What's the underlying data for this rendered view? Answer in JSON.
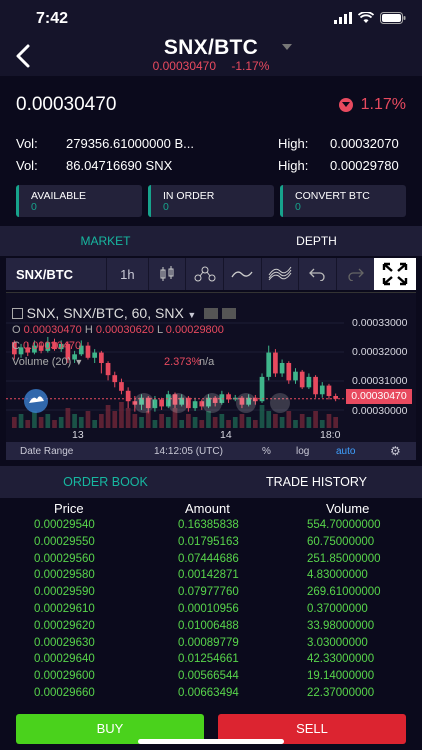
{
  "status": {
    "time": "7:42"
  },
  "header": {
    "pair": "SNX/BTC",
    "sub_price": "0.00030470",
    "sub_change": "-1.17%"
  },
  "ticker": {
    "last_price": "0.00030470",
    "change": "1.17%"
  },
  "stats": {
    "vol_label": "Vol:",
    "vol_1": "279356.61000000 B...",
    "vol_2": "86.04716690 SNX",
    "high_label": "High:",
    "high_1": "0.00032070",
    "high_2": "0.00029780"
  },
  "wallet": [
    {
      "label": "AVAILABLE",
      "value": "0"
    },
    {
      "label": "IN ORDER",
      "value": "0"
    },
    {
      "label": "CONVERT BTC",
      "value": "0"
    }
  ],
  "view_tabs": {
    "market": "MARKET",
    "depth": "DEPTH"
  },
  "chart_toolbar": {
    "symbol": "SNX/BTC",
    "interval": "1h"
  },
  "chart_overlay": {
    "symbol_line": "SNX, SNX/BTC, 60, SNX",
    "o_label": "O",
    "o_val": "0.00030470",
    "h_label": "H",
    "h_val": "0.00030620",
    "l_label": "L",
    "l_val": "0.00029800",
    "c_label": "C",
    "c_val": "0.00030470",
    "volume_label": "Volume (20)",
    "volume_pct": "2.373%",
    "volume_na": "n/a"
  },
  "chart_footer": {
    "date_range": "Date Range",
    "time": "14:12:05 (UTC)",
    "pct": "%",
    "log": "log",
    "auto": "auto"
  },
  "chart_data": {
    "type": "candlestick",
    "y_ticks": [
      "0.00033000",
      "0.00032000",
      "0.00031000",
      "0.00030000"
    ],
    "x_ticks": [
      "13",
      "14",
      "18:0"
    ],
    "last_price_tag": "0.00030470",
    "ylim": [
      0.000296,
      0.000334
    ],
    "candles": [
      [
        0.000321,
        0.0003175,
        0.0003215,
        0.000316,
        "down"
      ],
      [
        0.0003175,
        0.0003195,
        0.0003205,
        0.0003165,
        "up"
      ],
      [
        0.0003195,
        0.000318,
        0.000321,
        0.000317,
        "down"
      ],
      [
        0.000318,
        0.00032,
        0.0003215,
        0.0003175,
        "up"
      ],
      [
        0.00032,
        0.0003185,
        0.0003212,
        0.0003178,
        "down"
      ],
      [
        0.0003185,
        0.000321,
        0.0003225,
        0.000318,
        "up"
      ],
      [
        0.000321,
        0.000319,
        0.000322,
        0.0003185,
        "down"
      ],
      [
        0.000319,
        0.0003205,
        0.0003215,
        0.0003182,
        "up"
      ],
      [
        0.0003205,
        0.000316,
        0.0003212,
        0.000315,
        "down"
      ],
      [
        0.000316,
        0.0003175,
        0.0003185,
        0.000315,
        "up"
      ],
      [
        0.0003175,
        0.00032,
        0.0003215,
        0.000317,
        "up"
      ],
      [
        0.00032,
        0.0003165,
        0.000321,
        0.000316,
        "down"
      ],
      [
        0.0003165,
        0.000318,
        0.000319,
        0.000315,
        "up"
      ],
      [
        0.000318,
        0.000315,
        0.0003185,
        0.000312,
        "down"
      ],
      [
        0.000315,
        0.0003115,
        0.0003155,
        0.00031,
        "down"
      ],
      [
        0.0003115,
        0.0003095,
        0.0003125,
        0.000308,
        "down"
      ],
      [
        0.0003095,
        0.000307,
        0.0003105,
        0.000306,
        "down"
      ],
      [
        0.000307,
        0.000304,
        0.000308,
        0.000302,
        "down"
      ],
      [
        0.000304,
        0.000303,
        0.0003055,
        0.000301,
        "down"
      ],
      [
        0.000303,
        0.000305,
        0.000306,
        0.0003015,
        "up"
      ],
      [
        0.000305,
        0.000302,
        0.0003055,
        0.0003005,
        "down"
      ],
      [
        0.000302,
        0.0003045,
        0.0003055,
        0.000301,
        "up"
      ],
      [
        0.0003045,
        0.0003025,
        0.000305,
        0.0003015,
        "down"
      ],
      [
        0.0003025,
        0.000306,
        0.000307,
        0.000302,
        "up"
      ],
      [
        0.000306,
        0.000303,
        0.0003065,
        0.000302,
        "down"
      ],
      [
        0.000303,
        0.000305,
        0.000306,
        0.0003025,
        "up"
      ],
      [
        0.000305,
        0.000302,
        0.0003055,
        0.000301,
        "down"
      ],
      [
        0.000302,
        0.000304,
        0.000305,
        0.0003012,
        "up"
      ],
      [
        0.000304,
        0.0003025,
        0.0003045,
        0.0003015,
        "down"
      ],
      [
        0.0003025,
        0.000305,
        0.000306,
        0.000302,
        "up"
      ],
      [
        0.000305,
        0.0003035,
        0.0003055,
        0.0003025,
        "down"
      ],
      [
        0.0003035,
        0.000306,
        0.000307,
        0.000303,
        "up"
      ],
      [
        0.000306,
        0.0003045,
        0.0003065,
        0.0003035,
        "down"
      ],
      [
        0.0003045,
        0.000305,
        0.0003058,
        0.000304,
        "up"
      ],
      [
        0.000305,
        0.000303,
        0.0003055,
        0.000302,
        "down"
      ],
      [
        0.000303,
        0.000305,
        0.000306,
        0.0003025,
        "up"
      ],
      [
        0.000305,
        0.000304,
        0.0003058,
        0.000303,
        "down"
      ],
      [
        0.000304,
        0.000311,
        0.000312,
        0.0003035,
        "up"
      ],
      [
        0.000311,
        0.000318,
        0.00032,
        0.00031,
        "up"
      ],
      [
        0.000318,
        0.000312,
        0.000319,
        0.000311,
        "down"
      ],
      [
        0.000312,
        0.000315,
        0.000316,
        0.000311,
        "up"
      ],
      [
        0.000315,
        0.00031,
        0.0003155,
        0.000309,
        "down"
      ],
      [
        0.00031,
        0.0003125,
        0.0003135,
        0.000309,
        "up"
      ],
      [
        0.0003125,
        0.000308,
        0.000313,
        0.0003075,
        "down"
      ],
      [
        0.000308,
        0.000311,
        0.000312,
        0.0003075,
        "up"
      ],
      [
        0.000311,
        0.000306,
        0.0003115,
        0.000305,
        "down"
      ],
      [
        0.000306,
        0.0003085,
        0.0003095,
        0.000305,
        "up"
      ],
      [
        0.0003085,
        0.0003055,
        0.000309,
        0.0003045,
        "down"
      ],
      [
        0.0003055,
        0.0003047,
        0.0003062,
        0.000304,
        "down"
      ]
    ],
    "volumes": [
      0.4,
      0.5,
      0.3,
      0.6,
      0.4,
      0.5,
      0.3,
      0.4,
      0.7,
      0.5,
      0.4,
      0.6,
      0.3,
      0.5,
      0.8,
      0.6,
      0.9,
      0.7,
      0.5,
      0.4,
      0.6,
      0.3,
      0.5,
      0.4,
      0.7,
      0.3,
      0.5,
      0.4,
      0.3,
      0.6,
      0.4,
      0.5,
      0.3,
      0.4,
      0.5,
      0.4,
      0.3,
      0.8,
      0.6,
      0.5,
      0.4,
      0.6,
      0.3,
      0.5,
      0.4,
      0.6,
      0.3,
      0.5,
      0.4
    ]
  },
  "book_tabs": {
    "order_book": "ORDER BOOK",
    "trade_history": "TRADE HISTORY"
  },
  "book": {
    "headers": {
      "price": "Price",
      "amount": "Amount",
      "volume": "Volume"
    },
    "rows": [
      {
        "price": "0.00029540",
        "amount": "0.16385838",
        "volume": "554.70000000"
      },
      {
        "price": "0.00029550",
        "amount": "0.01795163",
        "volume": "60.75000000"
      },
      {
        "price": "0.00029560",
        "amount": "0.07444686",
        "volume": "251.85000000"
      },
      {
        "price": "0.00029580",
        "amount": "0.00142871",
        "volume": "4.83000000"
      },
      {
        "price": "0.00029590",
        "amount": "0.07977760",
        "volume": "269.61000000"
      },
      {
        "price": "0.00029610",
        "amount": "0.00010956",
        "volume": "0.37000000"
      },
      {
        "price": "0.00029620",
        "amount": "0.01006488",
        "volume": "33.98000000"
      },
      {
        "price": "0.00029630",
        "amount": "0.00089779",
        "volume": "3.03000000"
      },
      {
        "price": "0.00029640",
        "amount": "0.01254661",
        "volume": "42.33000000"
      },
      {
        "price": "0.00029600",
        "amount": "0.00566544",
        "volume": "19.14000000"
      },
      {
        "price": "0.00029660",
        "amount": "0.00663494",
        "volume": "22.37000000"
      }
    ]
  },
  "actions": {
    "buy": "BUY",
    "sell": "SELL"
  }
}
